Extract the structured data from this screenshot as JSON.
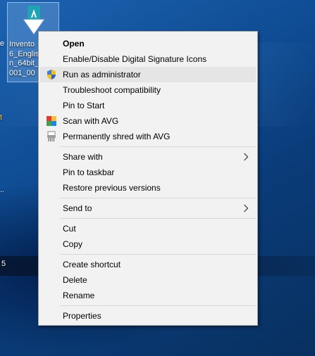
{
  "desktop": {
    "edge_fragments": [
      "e",
      "t",
      "..",
      "5"
    ],
    "selected_icon": {
      "name": "autodesk-inventor-installer-icon",
      "label_lines": [
        "Invento",
        "6_Englis",
        "n_64bit_",
        "001_00"
      ]
    }
  },
  "context_menu": {
    "groups": [
      [
        {
          "label": "Open",
          "bold": true,
          "icon": null,
          "submenu": false
        },
        {
          "label": "Enable/Disable Digital Signature Icons",
          "icon": null,
          "submenu": false
        },
        {
          "label": "Run as administrator",
          "icon": "uac-shield-icon",
          "highlighted": true,
          "submenu": false
        },
        {
          "label": "Troubleshoot compatibility",
          "icon": null,
          "submenu": false
        },
        {
          "label": "Pin to Start",
          "icon": null,
          "submenu": false
        },
        {
          "label": "Scan with AVG",
          "icon": "avg-icon",
          "submenu": false
        },
        {
          "label": "Permanently shred with AVG",
          "icon": "avg-shredder-icon",
          "submenu": false
        }
      ],
      [
        {
          "label": "Share with",
          "icon": null,
          "submenu": true
        },
        {
          "label": "Pin to taskbar",
          "icon": null,
          "submenu": false
        },
        {
          "label": "Restore previous versions",
          "icon": null,
          "submenu": false
        }
      ],
      [
        {
          "label": "Send to",
          "icon": null,
          "submenu": true
        }
      ],
      [
        {
          "label": "Cut",
          "icon": null,
          "submenu": false
        },
        {
          "label": "Copy",
          "icon": null,
          "submenu": false
        }
      ],
      [
        {
          "label": "Create shortcut",
          "icon": null,
          "submenu": false
        },
        {
          "label": "Delete",
          "icon": null,
          "submenu": false
        },
        {
          "label": "Rename",
          "icon": null,
          "submenu": false
        }
      ],
      [
        {
          "label": "Properties",
          "icon": null,
          "submenu": false
        }
      ]
    ]
  },
  "colors": {
    "menu_bg": "#f2f2f2",
    "menu_highlight": "#e5e5e5",
    "desktop_blue": "#0f4d95",
    "autodesk_teal": "#1fa3b5"
  }
}
